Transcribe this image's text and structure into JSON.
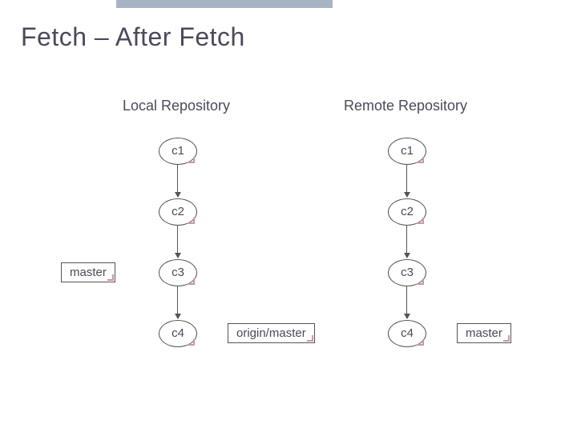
{
  "title": "Fetch – After Fetch",
  "columns": {
    "local": {
      "title": "Local Repository"
    },
    "remote": {
      "title": "Remote Repository"
    }
  },
  "commits": {
    "c1": "c1",
    "c2": "c2",
    "c3": "c3",
    "c4": "c4"
  },
  "labels": {
    "master_local_ptr": "master",
    "origin_master_ptr": "origin/master",
    "master_remote_ptr": "master"
  }
}
